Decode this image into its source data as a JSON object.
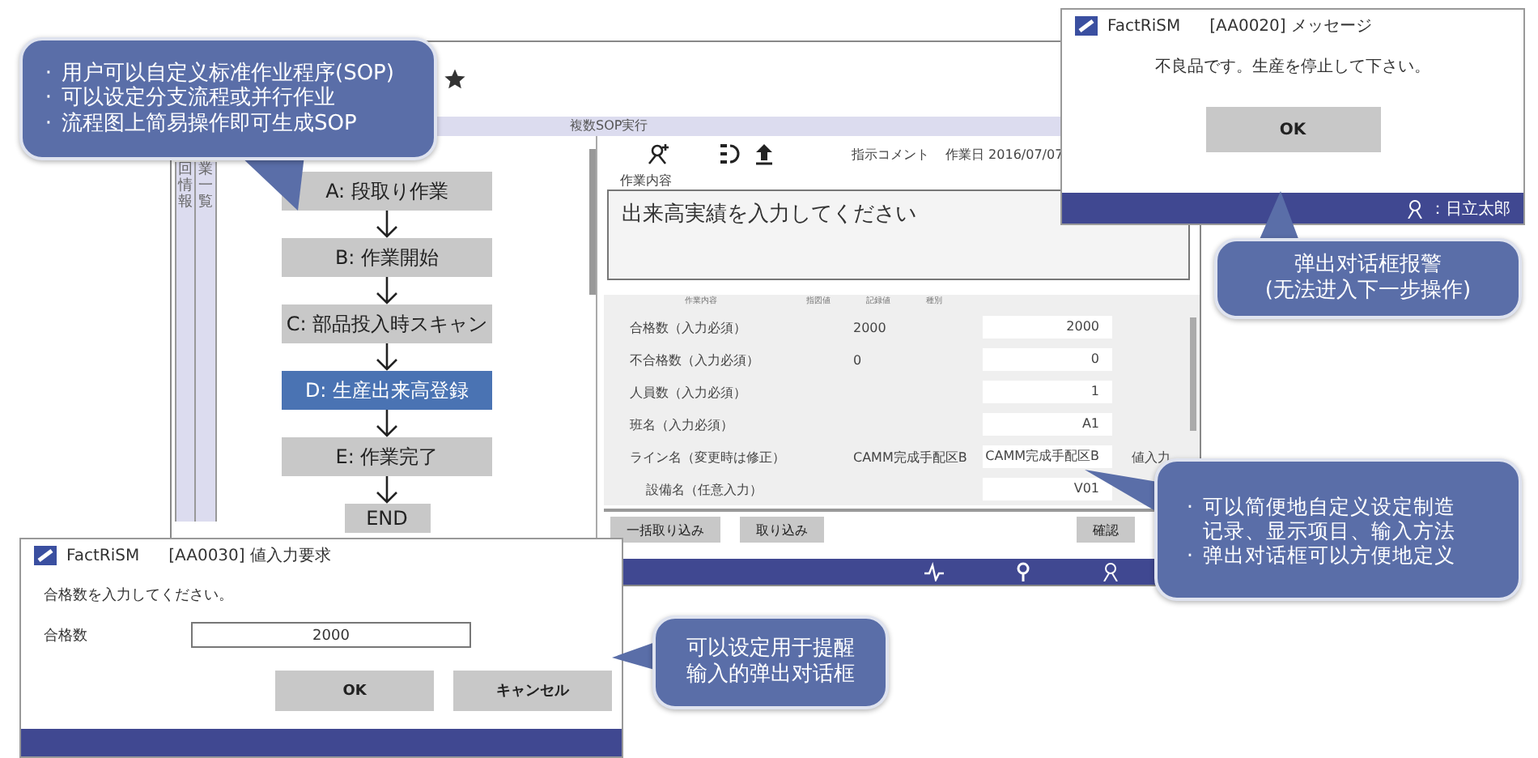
{
  "main_window": {
    "header": "複数SOP実行",
    "side_tabs": [
      {
        "label": "回情報"
      },
      {
        "label": "業一覧"
      }
    ],
    "flow_steps": [
      {
        "label": "A: 段取り作業",
        "selected": false,
        "kind": "step"
      },
      {
        "label": "B: 作業開始",
        "selected": false,
        "kind": "step"
      },
      {
        "label": "C: 部品投入時スキャン",
        "selected": false,
        "kind": "step"
      },
      {
        "label": "D: 生産出来高登録",
        "selected": true,
        "kind": "step"
      },
      {
        "label": "E: 作業完了",
        "selected": false,
        "kind": "step"
      },
      {
        "label": "END",
        "selected": false,
        "kind": "end"
      }
    ],
    "comment_label": "指示コメント",
    "work_date": "作業日 2016/07/07",
    "content_label": "作業内容",
    "content_text": "出来高実績を入力してください",
    "table": {
      "columns": [
        "作業内容",
        "指図値",
        "記録値",
        "種別"
      ],
      "rows": [
        {
          "label": "合格数（入力必須）",
          "planned": "2000",
          "value": "2000"
        },
        {
          "label": "不合格数（入力必須）",
          "planned": "0",
          "value": "0"
        },
        {
          "label": "人員数（入力必須）",
          "value": "1"
        },
        {
          "label": "班名（入力必須）",
          "value": "A1"
        },
        {
          "label": "ライン名（変更時は修正）",
          "planned": "CAMM完成手配区B",
          "value": "CAMM完成手配区B",
          "extra": "値入力"
        },
        {
          "label": "設備名（任意入力）",
          "value": "V01"
        }
      ]
    },
    "buttons": [
      "一括取り込み",
      "取り込み",
      "確認"
    ]
  },
  "message_dialog": {
    "app": "FactRiSM",
    "title": "[AA0020]  メッセージ",
    "message": "不良品です。生産を停止して下さい。",
    "button": "OK",
    "user": "：日立太郎"
  },
  "input_dialog": {
    "app": "FactRiSM",
    "title": "[AA0030]  値入力要求",
    "prompt": "合格数を入力してください。",
    "field_label": "合格数",
    "field_value": "2000",
    "buttons": [
      "OK",
      "キャンセル"
    ]
  },
  "callouts": [
    {
      "items": [
        {
          "bullet": "·",
          "lines": [
            "用户可以自定义标准作业程序(SOP)"
          ]
        },
        {
          "bullet": "·",
          "lines": [
            "可以设定分支流程或并行作业"
          ]
        },
        {
          "bullet": "·",
          "lines": [
            "流程图上简易操作即可生成SOP"
          ]
        }
      ]
    },
    {
      "items": [
        {
          "lines": [
            "弹出对话框报警",
            "(无法进入下一步操作)"
          ]
        }
      ]
    },
    {
      "items": [
        {
          "bullet": "·",
          "lines": [
            "可以简便地自定义设定制造",
            "记录、显示项目、输入方法"
          ]
        },
        {
          "bullet": "·",
          "lines": [
            "弹出对话框可以方便地定义"
          ]
        }
      ]
    },
    {
      "items": [
        {
          "lines": [
            "可以设定用于提醒",
            "输入的弹出对话框"
          ]
        }
      ]
    }
  ]
}
